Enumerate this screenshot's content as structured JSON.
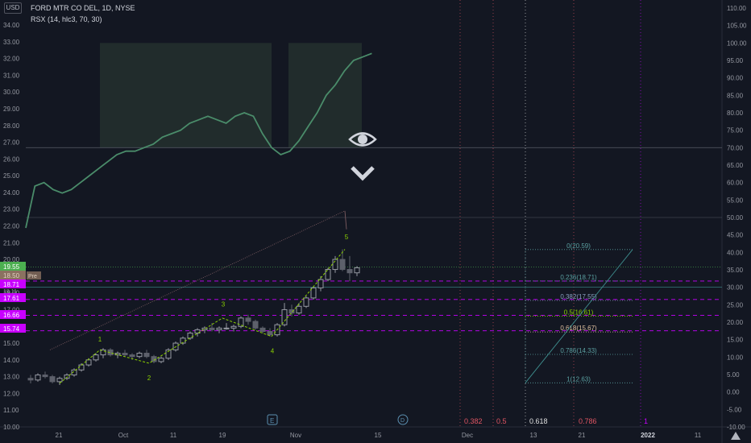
{
  "header": {
    "symbol_line": "FORD MTR CO DEL, 1D, NYSE",
    "indicator_line": "RSX (14, hlc3, 70, 30)",
    "currency_button": "USD"
  },
  "colors": {
    "background": "#131722",
    "candle": "#787b86",
    "wave": "#8bd100",
    "fib_purple": "#c800ff",
    "fib_teal": "#3f8f8f",
    "rsx_line": "#4a8c6a",
    "trendline": "#7b5b60"
  },
  "icons": [
    "eye-icon",
    "chevron-down-icon",
    "event-icon",
    "dividend-icon"
  ],
  "price_axis": {
    "ticks": [
      "34.00",
      "33.00",
      "32.00",
      "31.00",
      "30.00",
      "29.00",
      "28.00",
      "27.00",
      "26.00",
      "25.00",
      "24.00",
      "23.00",
      "22.00",
      "21.00",
      "20.00",
      "19.00",
      "18.00",
      "17.00",
      "16.00",
      "15.00",
      "14.00",
      "13.00",
      "12.00",
      "11.00",
      "10.00"
    ],
    "badges": [
      {
        "label": "19.55",
        "price": 19.55,
        "color": "#4caf50",
        "text_color": "#ffffff"
      },
      {
        "label": "18.50",
        "price": 18.5,
        "color": "#8b7160",
        "text_color": "#e0d0c0",
        "tag": "Pre"
      },
      {
        "label": "18.71",
        "price": 18.71,
        "color": "#c800ff",
        "text_color": "#ffffff"
      },
      {
        "label": "17.61",
        "price": 17.61,
        "color": "#c800ff",
        "text_color": "#ffffff"
      },
      {
        "label": "16.66",
        "price": 16.66,
        "color": "#c800ff",
        "text_color": "#ffffff"
      },
      {
        "label": "15.74",
        "price": 15.74,
        "color": "#c800ff",
        "text_color": "#ffffff"
      }
    ],
    "partial_label": "18.11"
  },
  "rsx_axis": {
    "ticks": [
      "110.00",
      "105.00",
      "100.00",
      "95.00",
      "90.00",
      "85.00",
      "80.00",
      "75.00",
      "70.00",
      "65.00",
      "60.00",
      "55.00",
      "50.00",
      "45.00",
      "40.00",
      "35.00",
      "30.00",
      "25.00",
      "20.00",
      "15.00",
      "10.00",
      "5.00",
      "0.00",
      "-5.00",
      "-10.00"
    ]
  },
  "time_axis": {
    "labels": [
      "21",
      "Oct",
      "11",
      "19",
      "Nov",
      "15",
      "Dec",
      "13",
      "21",
      "2022",
      "11"
    ]
  },
  "fib_bottom_labels": [
    {
      "text": "0.382",
      "color": "#e05563"
    },
    {
      "text": "0.5",
      "color": "#e05563"
    },
    {
      "text": "0.618",
      "color": "#e0e0e0"
    },
    {
      "text": "0.786",
      "color": "#e05563"
    },
    {
      "text": "1",
      "color": "#c800ff"
    }
  ],
  "fib_retracement": [
    {
      "label": "0(20.59)",
      "price": 20.59,
      "color": "#5a9fa0"
    },
    {
      "label": "0.236(18.71)",
      "price": 18.71,
      "color": "#5a9fa0"
    },
    {
      "label": "0.382(17.55)",
      "price": 17.55,
      "color": "#8aa0c0"
    },
    {
      "label": "0.5(16.61)",
      "price": 16.61,
      "color": "#8bd100"
    },
    {
      "label": "0.618(15.67)",
      "price": 15.67,
      "color": "#e0c0a0"
    },
    {
      "label": "0.786(14.33)",
      "price": 14.33,
      "color": "#5a9fa0"
    },
    {
      "label": "1(12.63)",
      "price": 12.63,
      "color": "#5a9fa0"
    }
  ],
  "wave_labels": [
    "1",
    "2",
    "3",
    "4",
    "5"
  ],
  "chart_data": {
    "type": "candlestick",
    "title": "FORD MTR CO DEL, 1D, NYSE",
    "ylim": [
      10,
      34.5
    ],
    "candles": [
      [
        12.9,
        13.1,
        12.6,
        12.8
      ],
      [
        12.8,
        13.2,
        12.7,
        13.1
      ],
      [
        13.1,
        13.3,
        12.9,
        13.0
      ],
      [
        13.0,
        13.1,
        12.6,
        12.7
      ],
      [
        12.7,
        13.0,
        12.5,
        12.9
      ],
      [
        12.9,
        13.2,
        12.8,
        13.1
      ],
      [
        13.1,
        13.5,
        13.0,
        13.4
      ],
      [
        13.4,
        13.8,
        13.3,
        13.7
      ],
      [
        13.7,
        14.1,
        13.6,
        14.0
      ],
      [
        14.0,
        14.4,
        13.9,
        14.3
      ],
      [
        14.3,
        14.7,
        14.1,
        14.6
      ],
      [
        14.6,
        14.7,
        14.2,
        14.3
      ],
      [
        14.3,
        14.5,
        14.1,
        14.4
      ],
      [
        14.4,
        14.6,
        14.2,
        14.3
      ],
      [
        14.3,
        14.4,
        14.0,
        14.2
      ],
      [
        14.2,
        14.5,
        14.1,
        14.4
      ],
      [
        14.4,
        14.6,
        14.1,
        14.2
      ],
      [
        14.2,
        14.3,
        13.8,
        13.9
      ],
      [
        13.9,
        14.2,
        13.8,
        14.1
      ],
      [
        14.1,
        14.7,
        14.0,
        14.6
      ],
      [
        14.6,
        15.1,
        14.5,
        15.0
      ],
      [
        15.0,
        15.4,
        14.9,
        15.3
      ],
      [
        15.3,
        15.7,
        15.2,
        15.6
      ],
      [
        15.6,
        15.9,
        15.4,
        15.8
      ],
      [
        15.8,
        16.0,
        15.6,
        15.9
      ],
      [
        15.9,
        16.2,
        15.7,
        15.8
      ],
      [
        15.8,
        16.0,
        15.6,
        15.9
      ],
      [
        15.9,
        16.2,
        15.8,
        15.9
      ],
      [
        15.9,
        16.1,
        15.7,
        16.0
      ],
      [
        16.0,
        16.6,
        15.9,
        16.5
      ],
      [
        16.5,
        16.7,
        16.1,
        16.3
      ],
      [
        16.3,
        16.4,
        15.8,
        15.9
      ],
      [
        15.9,
        16.0,
        15.6,
        15.7
      ],
      [
        15.7,
        15.9,
        15.4,
        15.5
      ],
      [
        15.5,
        16.2,
        15.4,
        16.1
      ],
      [
        16.1,
        17.4,
        16.0,
        17.0
      ],
      [
        17.0,
        17.3,
        16.6,
        16.8
      ],
      [
        16.8,
        17.4,
        16.7,
        17.2
      ],
      [
        17.2,
        17.8,
        17.1,
        17.7
      ],
      [
        17.7,
        18.4,
        17.6,
        18.3
      ],
      [
        18.3,
        19.0,
        18.1,
        18.8
      ],
      [
        18.8,
        19.5,
        18.7,
        19.4
      ],
      [
        19.4,
        20.2,
        19.2,
        20.0
      ],
      [
        20.0,
        20.6,
        19.3,
        19.4
      ],
      [
        19.4,
        20.2,
        18.7,
        19.2
      ],
      [
        19.2,
        19.6,
        19.0,
        19.5
      ]
    ],
    "waves": [
      [
        12.6,
        12.8
      ],
      [
        14.6,
        14.6
      ],
      [
        13.8,
        13.9
      ],
      [
        16.5,
        16.5
      ],
      [
        15.4,
        15.5
      ],
      [
        20.6,
        20.4
      ]
    ],
    "rsx": [
      47,
      59,
      60,
      58,
      57,
      58,
      60,
      62,
      64,
      66,
      68,
      69,
      69,
      70,
      71,
      73,
      74,
      75,
      77,
      78,
      79,
      78,
      77,
      79,
      80,
      79,
      74,
      70,
      68,
      69,
      72,
      76,
      80,
      85,
      88,
      92,
      95,
      96,
      97
    ],
    "rsx_ylim": [
      -10,
      110
    ],
    "overbought": 70,
    "oversold": 30
  }
}
